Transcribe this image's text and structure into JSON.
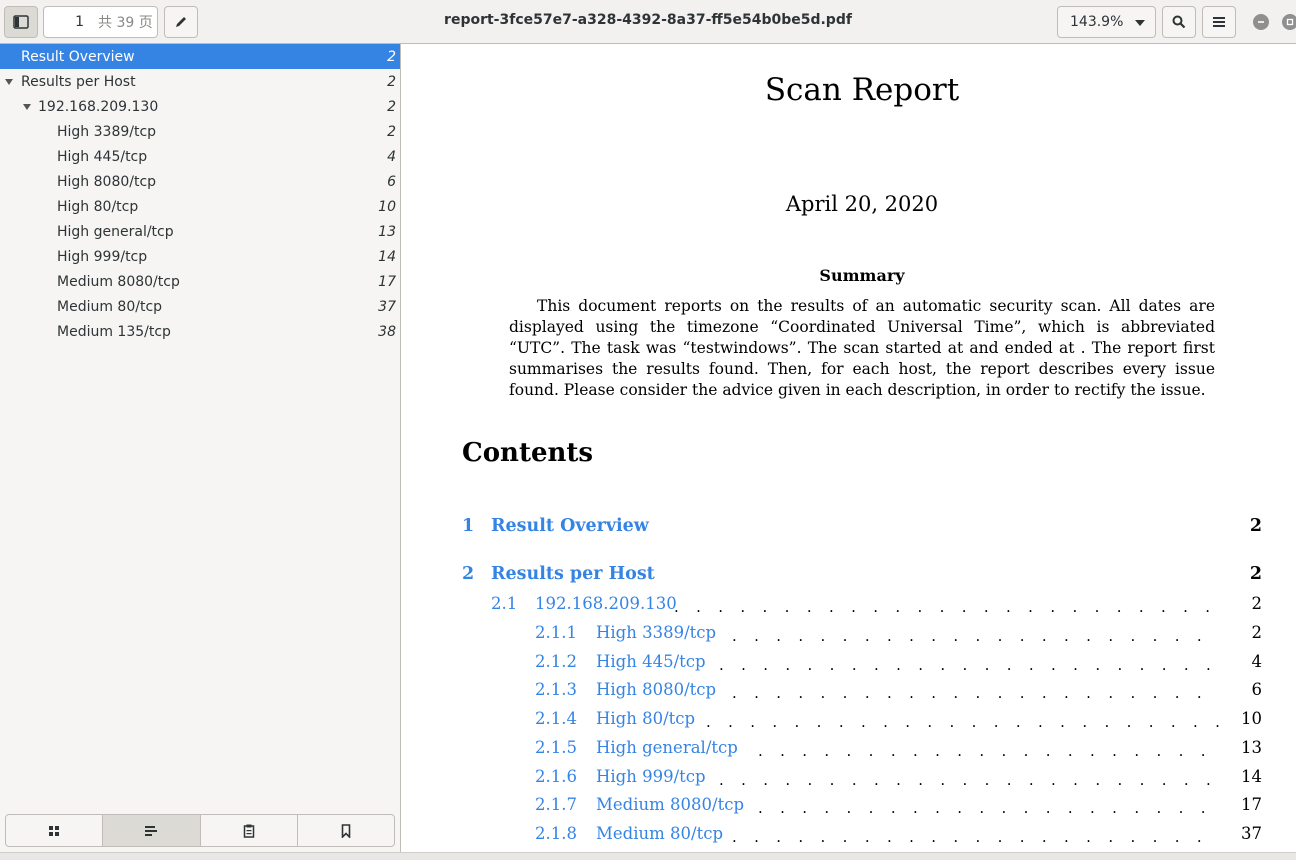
{
  "header": {
    "page_number": "1",
    "page_total": "共 39 页",
    "document_title": "report-3fce57e7-a328-4392-8a37-ff5e54b0be5d.pdf",
    "zoom": "143.9%"
  },
  "sidebar": {
    "outline": [
      {
        "label": "Result Overview",
        "page": "2"
      },
      {
        "label": "Results per Host",
        "page": "2"
      },
      {
        "label": "192.168.209.130",
        "page": "2"
      },
      {
        "label": "High 3389/tcp",
        "page": "2"
      },
      {
        "label": "High 445/tcp",
        "page": "4"
      },
      {
        "label": "High 8080/tcp",
        "page": "6"
      },
      {
        "label": "High 80/tcp",
        "page": "10"
      },
      {
        "label": "High general/tcp",
        "page": "13"
      },
      {
        "label": "High 999/tcp",
        "page": "14"
      },
      {
        "label": "Medium 8080/tcp",
        "page": "17"
      },
      {
        "label": "Medium 80/tcp",
        "page": "37"
      },
      {
        "label": "Medium 135/tcp",
        "page": "38"
      }
    ]
  },
  "document": {
    "title": "Scan Report",
    "date": "April 20, 2020",
    "summary_heading": "Summary",
    "summary_text": "This document reports on the results of an automatic security scan. All dates are displayed using the timezone “Coordinated Universal Time”, which is abbreviated “UTC”. The task was “testwindows”. The scan started at and ended at . The report first summarises the results found. Then, for each host, the report describes every issue found. Please consider the advice given in each description, in order to rectify the issue.",
    "contents_heading": "Contents",
    "toc": [
      {
        "num": "1",
        "text": "Result Overview",
        "page": "2"
      },
      {
        "num": "2",
        "text": "Results per Host",
        "page": "2"
      },
      {
        "num": "2.1",
        "text": "192.168.209.130",
        "page": "2"
      },
      {
        "num": "2.1.1",
        "text": "High 3389/tcp",
        "page": "2"
      },
      {
        "num": "2.1.2",
        "text": "High 445/tcp",
        "page": "4"
      },
      {
        "num": "2.1.3",
        "text": "High 8080/tcp",
        "page": "6"
      },
      {
        "num": "2.1.4",
        "text": "High 80/tcp",
        "page": "10"
      },
      {
        "num": "2.1.5",
        "text": "High general/tcp",
        "page": "13"
      },
      {
        "num": "2.1.6",
        "text": "High 999/tcp",
        "page": "14"
      },
      {
        "num": "2.1.7",
        "text": "Medium 8080/tcp",
        "page": "17"
      },
      {
        "num": "2.1.8",
        "text": "Medium 80/tcp",
        "page": "37"
      }
    ]
  },
  "colors": {
    "accent": "#3584e4",
    "link": "#3584e4"
  }
}
